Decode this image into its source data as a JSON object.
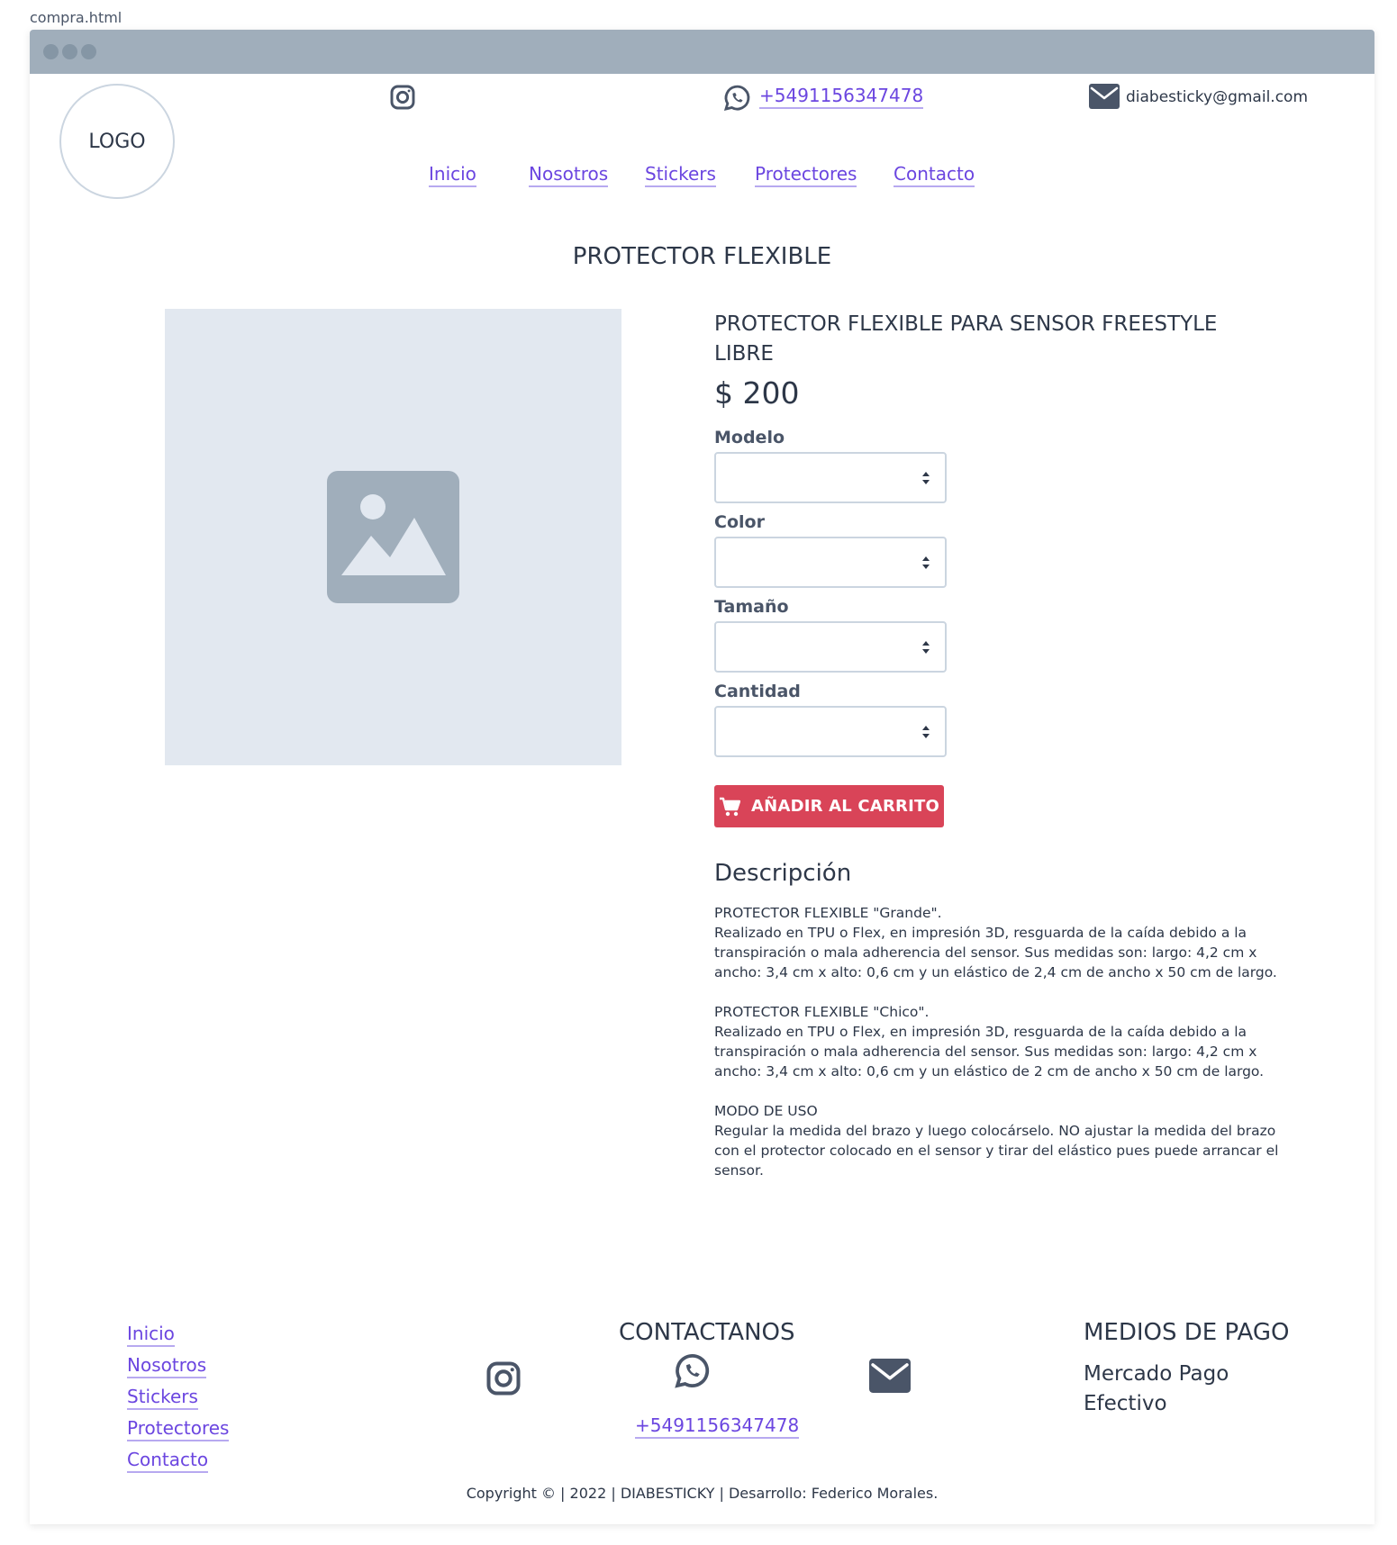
{
  "file": {
    "name": "compra.html"
  },
  "header": {
    "logo_text": "LOGO",
    "phone": "+5491156347478",
    "email": "diabesticky@gmail.com"
  },
  "nav": {
    "items": [
      {
        "label": "Inicio"
      },
      {
        "label": "Nosotros"
      },
      {
        "label": "Stickers"
      },
      {
        "label": "Protectores"
      },
      {
        "label": "Contacto"
      }
    ]
  },
  "page": {
    "title": "PROTECTOR FLEXIBLE"
  },
  "product": {
    "name": "PROTECTOR FLEXIBLE PARA SENSOR FREESTYLE LIBRE",
    "price": "$ 200",
    "fields": {
      "model": {
        "label": "Modelo",
        "value": ""
      },
      "color": {
        "label": "Color",
        "value": ""
      },
      "size": {
        "label": "Tamaño",
        "value": ""
      },
      "quantity": {
        "label": "Cantidad",
        "value": ""
      }
    },
    "add_to_cart_label": "AÑADIR AL CARRITO"
  },
  "description": {
    "title": "Descripción",
    "blocks": [
      {
        "heading": "PROTECTOR FLEXIBLE \"Grande\".",
        "text": "Realizado en TPU o Flex, en impresión 3D, resguarda de la caída debido a la transpiración o mala adherencia del sensor. Sus medidas son: largo: 4,2 cm x ancho: 3,4 cm x alto: 0,6 cm y un elástico de 2,4 cm de ancho x 50 cm de largo."
      },
      {
        "heading": "PROTECTOR FLEXIBLE \"Chico\".",
        "text": "Realizado en TPU o Flex, en impresión 3D, resguarda de la caída debido a la transpiración o mala adherencia del sensor. Sus medidas son: largo: 4,2 cm x ancho: 3,4 cm x alto: 0,6 cm y un elástico de 2 cm de ancho x 50 cm de largo."
      },
      {
        "heading": "MODO DE USO",
        "text": "Regular la medida del brazo y luego colocárselo. NO ajustar la medida del brazo con el protector colocado en el sensor y tirar del elástico pues puede arrancar el sensor."
      }
    ]
  },
  "footer": {
    "links": [
      {
        "label": "Inicio"
      },
      {
        "label": "Nosotros"
      },
      {
        "label": "Stickers"
      },
      {
        "label": "Protectores"
      },
      {
        "label": "Contacto"
      }
    ],
    "contact_heading": "CONTACTANOS",
    "phone": "+5491156347478",
    "payment_heading": "MEDIOS DE PAGO",
    "payment_methods": [
      "Mercado Pago",
      "Efectivo"
    ],
    "copyright": "Copyright © | 2022 | DIABESTICKY | Desarrollo: Federico Morales."
  },
  "colors": {
    "link": "#6b46e0",
    "cart_button": "#d94458",
    "titlebar": "#a0aebb",
    "placeholder_bg": "#e2e8f0",
    "icon": "#4a5568"
  },
  "icons": {
    "instagram": "instagram-icon",
    "whatsapp": "whatsapp-icon",
    "email": "mail-icon",
    "image": "image-placeholder-icon",
    "cart": "cart-icon",
    "select_caret": "sort-caret-icon"
  }
}
